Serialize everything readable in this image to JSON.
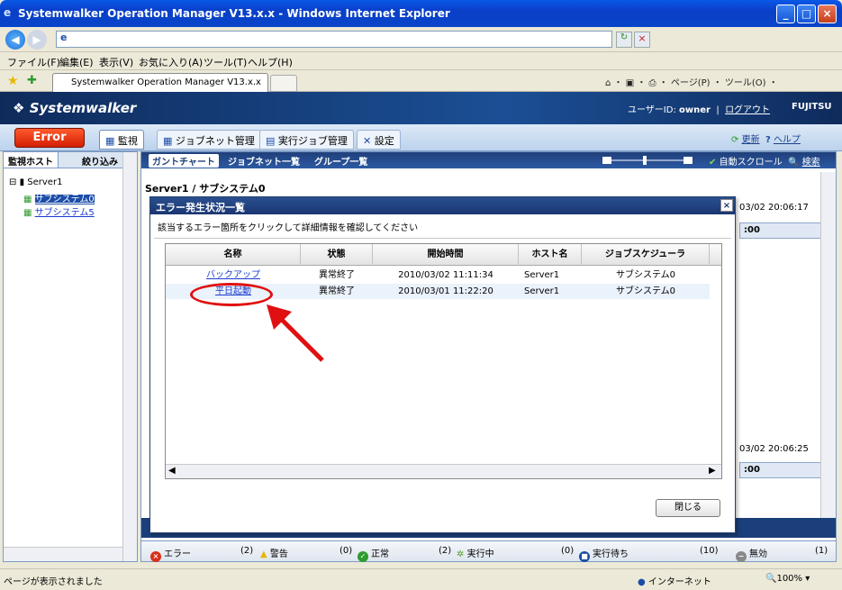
{
  "browser": {
    "title": "Systemwalker Operation Manager V13.x.x - Windows Internet Explorer",
    "menu": [
      "ファイル(F)",
      "編集(E)",
      "表示(V)",
      "お気に入り(A)",
      "ツール(T)",
      "ヘルプ(H)"
    ],
    "tab_label": "Systemwalker Operation Manager V13.x.x",
    "toolbar_right": "ページ(P) ・ ツール(O) ・",
    "status_left": "ページが表示されました",
    "status_zone": "インターネット",
    "zoom": "100%"
  },
  "app": {
    "logo": "Systemwalker",
    "user_label": "ユーザーID:",
    "user": "owner",
    "logout": "ログアウト",
    "vendor": "FUJITSU",
    "error_button": "Error",
    "nav_tabs": [
      "監視",
      "ジョブネット管理",
      "実行ジョブ管理",
      "設定"
    ],
    "refresh": "更新",
    "help": "ヘルプ"
  },
  "left_panel": {
    "tabs": [
      "監視ホスト",
      "絞り込み"
    ],
    "tree": {
      "root": "Server1",
      "children": [
        "サブシステム0",
        "サブシステム5"
      ]
    }
  },
  "main": {
    "tabs": [
      "ガントチャート",
      "ジョブネット一覧",
      "グループ一覧"
    ],
    "autoscroll": "自動スクロール",
    "search": "検索",
    "server_title": "Server1 / サブシステム0",
    "bg_time1": "03/02 20:06:17",
    "bg_time2": "03/02 20:06:25",
    "bg_hdr": ":00"
  },
  "statusbar": [
    {
      "label": "エラー",
      "count": "(2)",
      "color": "#d9301c"
    },
    {
      "label": "警告",
      "count": "(0)",
      "color": "#e8b400"
    },
    {
      "label": "正常",
      "count": "(2)",
      "color": "#2e9b2e"
    },
    {
      "label": "実行中",
      "count": "(0)",
      "color": "#5aa02c"
    },
    {
      "label": "実行待ち",
      "count": "(10)",
      "color": "#1b4da8"
    },
    {
      "label": "無効",
      "count": "(1)",
      "color": "#888888"
    }
  ],
  "dialog": {
    "title": "エラー発生状況一覧",
    "message": "該当するエラー箇所をクリックして詳細情報を確認してください",
    "columns": [
      "名称",
      "状態",
      "開始時間",
      "ホスト名",
      "ジョブスケジューラ"
    ],
    "rows": [
      {
        "name": "バックアップ",
        "status": "異常終了",
        "start": "2010/03/02 11:11:34",
        "host": "Server1",
        "scheduler": "サブシステム0"
      },
      {
        "name": "平日起動",
        "status": "異常終了",
        "start": "2010/03/01 11:22:20",
        "host": "Server1",
        "scheduler": "サブシステム0"
      }
    ],
    "close": "閉じる"
  }
}
